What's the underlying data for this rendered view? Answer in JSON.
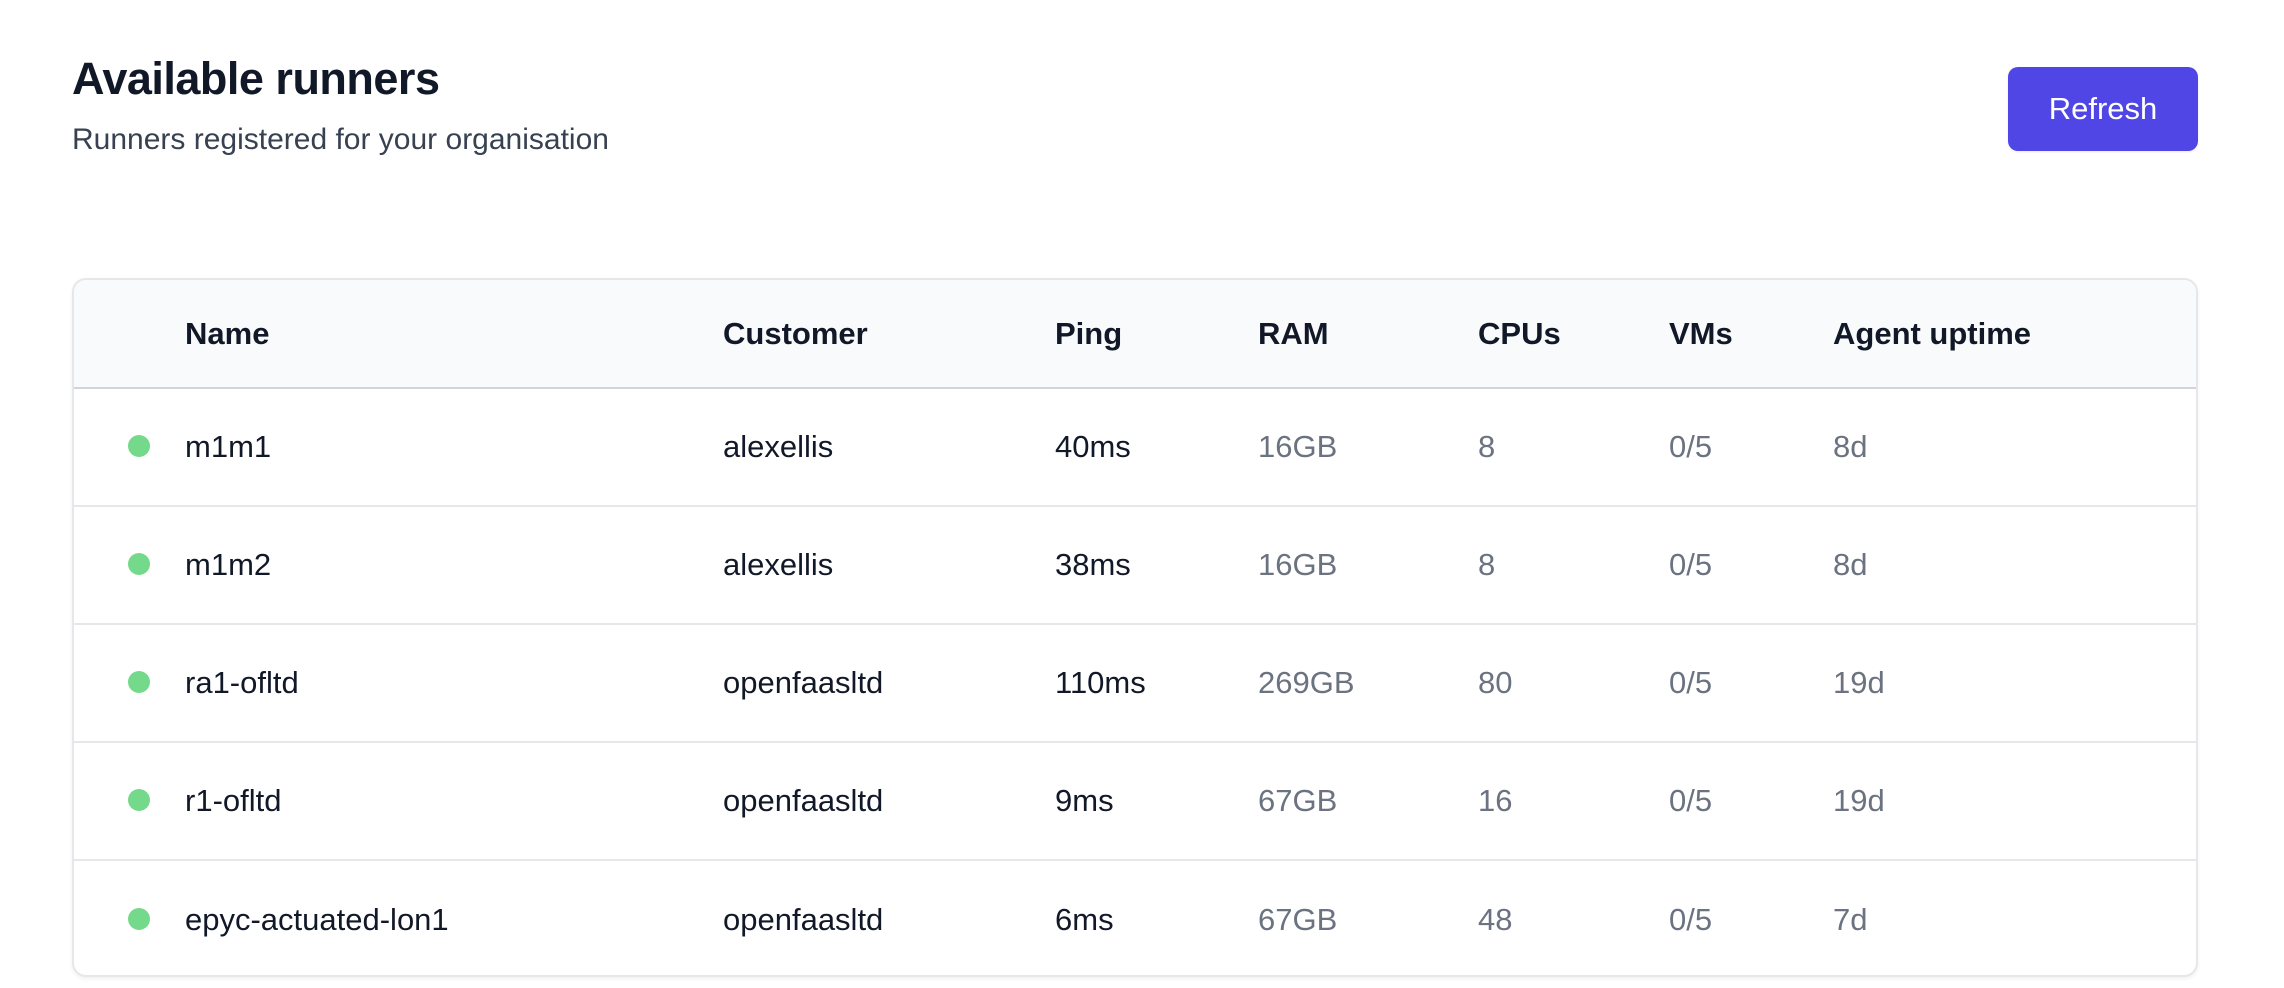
{
  "header": {
    "title": "Available runners",
    "subtitle": "Runners registered for your organisation",
    "refresh_label": "Refresh"
  },
  "colors": {
    "accent": "#4f46e5",
    "status_online": "#74d98a"
  },
  "table": {
    "columns": [
      "Name",
      "Customer",
      "Ping",
      "RAM",
      "CPUs",
      "VMs",
      "Agent uptime"
    ],
    "rows": [
      {
        "status": "online",
        "name": "m1m1",
        "customer": "alexellis",
        "ping": "40ms",
        "ram": "16GB",
        "cpus": "8",
        "vms": "0/5",
        "uptime": "8d"
      },
      {
        "status": "online",
        "name": "m1m2",
        "customer": "alexellis",
        "ping": "38ms",
        "ram": "16GB",
        "cpus": "8",
        "vms": "0/5",
        "uptime": "8d"
      },
      {
        "status": "online",
        "name": "ra1-ofltd",
        "customer": "openfaasltd",
        "ping": "110ms",
        "ram": "269GB",
        "cpus": "80",
        "vms": "0/5",
        "uptime": "19d"
      },
      {
        "status": "online",
        "name": "r1-ofltd",
        "customer": "openfaasltd",
        "ping": "9ms",
        "ram": "67GB",
        "cpus": "16",
        "vms": "0/5",
        "uptime": "19d"
      },
      {
        "status": "online",
        "name": "epyc-actuated-lon1",
        "customer": "openfaasltd",
        "ping": "6ms",
        "ram": "67GB",
        "cpus": "48",
        "vms": "0/5",
        "uptime": "7d"
      }
    ]
  }
}
